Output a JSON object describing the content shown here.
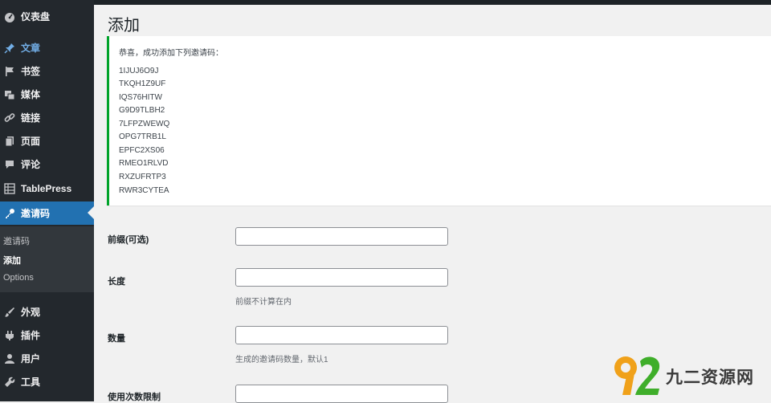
{
  "sidebar": {
    "items": [
      {
        "label": "仪表盘",
        "icon": "dashboard-icon"
      },
      {
        "label": "文章",
        "icon": "pin-icon"
      },
      {
        "label": "书签",
        "icon": "flag-icon"
      },
      {
        "label": "媒体",
        "icon": "media-icon"
      },
      {
        "label": "链接",
        "icon": "link-icon"
      },
      {
        "label": "页面",
        "icon": "page-icon"
      },
      {
        "label": "评论",
        "icon": "comment-icon"
      },
      {
        "label": "TablePress",
        "icon": "table-icon"
      },
      {
        "label": "邀请码",
        "icon": "key-icon"
      },
      {
        "label": "外观",
        "icon": "brush-icon"
      },
      {
        "label": "插件",
        "icon": "plugin-icon"
      },
      {
        "label": "用户",
        "icon": "user-icon"
      },
      {
        "label": "工具",
        "icon": "wrench-icon"
      }
    ],
    "submenu": [
      {
        "label": "邀请码"
      },
      {
        "label": "添加"
      },
      {
        "label": "Options"
      }
    ]
  },
  "page": {
    "title": "添加",
    "notice_message": "恭喜，成功添加下列邀请码：",
    "codes": [
      "1IJUJ6O9J",
      "TKQH1Z9UF",
      "IQS76HITW",
      "G9D9TLBH2",
      "7LFPZWEWQ",
      "OPG7TRB1L",
      "EPFC2XS06",
      "RMEO1RLVD",
      "RXZUFRTP3",
      "RWR3CYTEA"
    ]
  },
  "form": {
    "prefix_label": "前缀(可选)",
    "prefix_value": "",
    "length_label": "长度",
    "length_value": "",
    "length_desc": "前缀不计算在内",
    "count_label": "数量",
    "count_value": "",
    "count_desc": "生成的邀请码数量，默认1",
    "limit_label": "使用次数限制",
    "limit_value": ""
  },
  "watermark": {
    "text": "九二资源网",
    "logo_number": "92"
  },
  "colors": {
    "sidebar_bg": "#23282d",
    "active_bg": "#2271b1",
    "link_blue": "#72aee6",
    "success_green": "#00a32a",
    "watermark_orange": "#f0a11a",
    "watermark_green": "#3fae2a"
  }
}
